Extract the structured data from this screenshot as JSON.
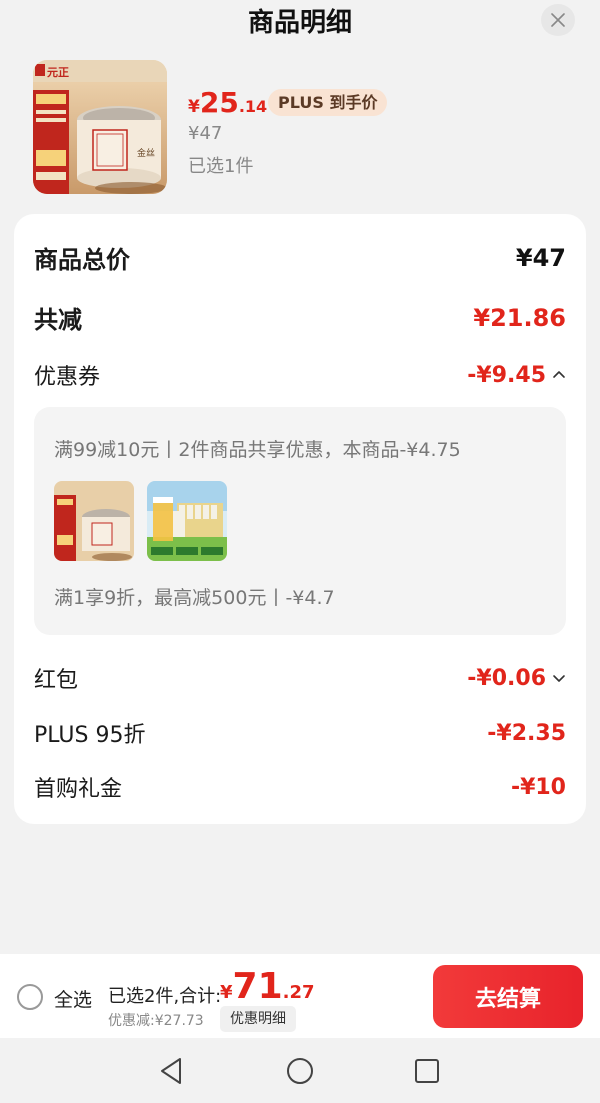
{
  "header": {
    "title": "商品明细"
  },
  "product": {
    "price_symbol": "¥",
    "price_int": "25",
    "price_dec": ".14",
    "plus_badge": "PLUS 到手价",
    "original_price": "¥47",
    "selected_count": "已选1件",
    "brand": "元正"
  },
  "summary": {
    "total_label": "商品总价",
    "total_value": "¥47",
    "reduce_label": "共减",
    "reduce_value": "¥21.86",
    "coupon_label": "优惠券",
    "coupon_value": "-¥9.45",
    "coupon_line1": "满99减10元丨2件商品共享优惠，本商品-¥4.75",
    "coupon_line2": "满1享9折，最高减500元丨-¥4.7",
    "redpacket_label": "红包",
    "redpacket_value": "-¥0.06",
    "plus_label": "PLUS 95折",
    "plus_value": "-¥2.35",
    "gift_label": "首购礼金",
    "gift_value": "-¥10"
  },
  "bottom": {
    "select_all": "全选",
    "total_label": "已选2件,合计:",
    "total_symbol": "¥",
    "total_int": "71",
    "total_dec": ".27",
    "discount_note": "优惠减:¥27.73",
    "detail_chip": "优惠明细",
    "checkout": "去结算"
  },
  "colors": {
    "accent_red": "#e1251b",
    "plus_badge_bg": "#f9e3d3",
    "checkout_bg": "#e8232b"
  },
  "icons": [
    "close-icon",
    "chevron-up-icon",
    "chevron-down-icon",
    "back-triangle-icon",
    "home-circle-icon",
    "recents-square-icon"
  ]
}
